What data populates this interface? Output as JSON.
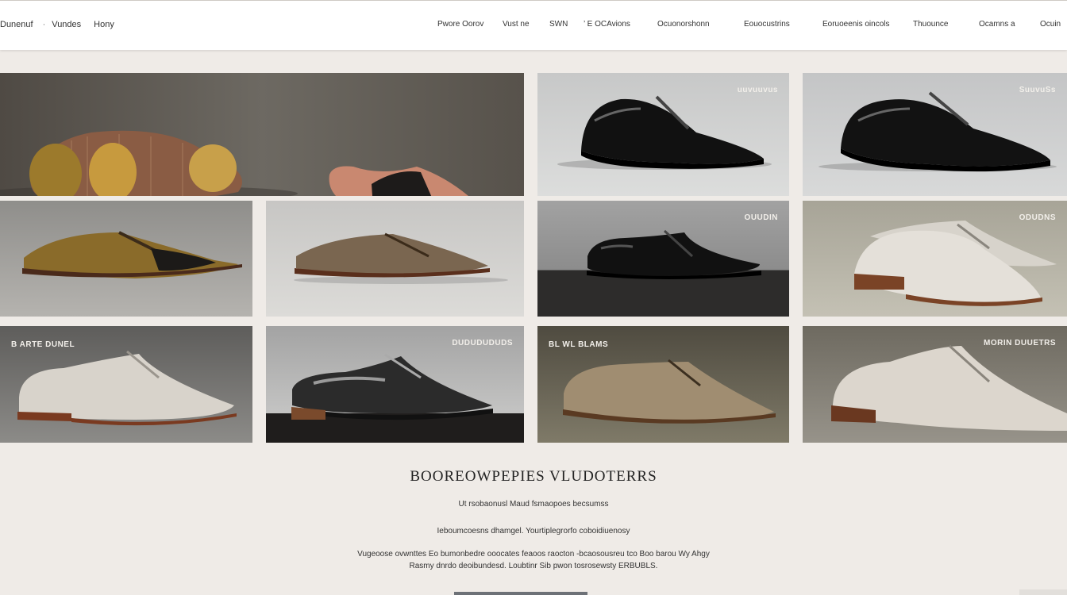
{
  "header": {
    "brand_items": [
      "Dunenuf",
      "Vundes",
      "Hony"
    ],
    "nav": [
      "Pwore Oorov",
      "Vust ne",
      "SWN",
      "’ E OCAvions",
      "Ocuonorshonn",
      "Eouocustrins",
      "Eoruoeenis oincols",
      "Thuounce",
      "Ocamns a",
      "Ocuin"
    ]
  },
  "tiles": [
    {
      "tag": ""
    },
    {
      "tag": "uuvuuvus"
    },
    {
      "tag": "SuuvuSs"
    },
    {
      "tag": ""
    },
    {
      "tag": ""
    },
    {
      "tag": "OUUDIN"
    },
    {
      "tag": "ODUDNS"
    },
    {
      "tag": "B ARTE DUNEL"
    },
    {
      "tag": "DUDUDUDUDS"
    },
    {
      "tag": "BL WL BLAMS"
    },
    {
      "tag": "MORIN DUUETRS"
    }
  ],
  "footer": {
    "title": "BOOREOWPEPIES VLUDOTERRS",
    "subtitle": "Ut rsobaonusl Maud fsmaopoes becsumss",
    "line": "Ieboumcoesns dhamgel. Yourtiplegrorfo coboidiuenosy",
    "para1": "Vugeoose ovwnttes   Eo bumonbedre  ooocates feaoos raocton  -bcaosousreu tco  Boo  barou  Wy Ahgy",
    "para2": "Rasmy dnrdo deoibundesd. Loubtinr Sib pwon tosrosewsty ERBUBLS."
  },
  "colors": {
    "background": "#efebe7",
    "topbar": "#ffffff"
  }
}
